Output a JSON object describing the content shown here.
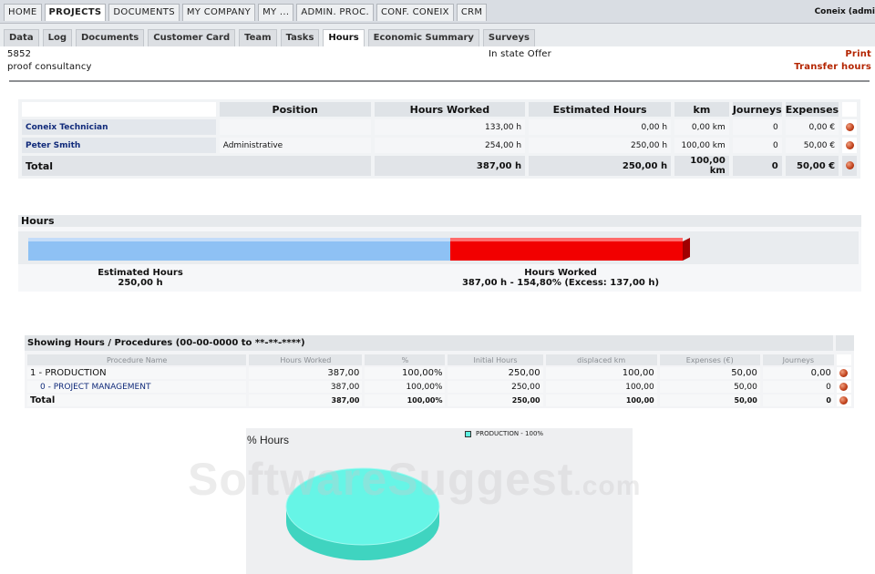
{
  "top_nav": {
    "tabs": [
      "HOME",
      "PROJECTS",
      "DOCUMENTS",
      "MY COMPANY",
      "MY ...",
      "ADMIN. PROC.",
      "CONF. CONEIX",
      "CRM"
    ],
    "user_label": "Coneix (admi"
  },
  "sub_nav": {
    "tabs": [
      "Data",
      "Log",
      "Documents",
      "Customer Card",
      "Team",
      "Tasks",
      "Hours",
      "Economic Summary",
      "Surveys"
    ]
  },
  "project": {
    "id": "5852",
    "name": "proof consultancy",
    "state": "In state Offer",
    "print_label": "Print",
    "transfer_label": "Transfer hours"
  },
  "team_table": {
    "headers": [
      "Position",
      "Hours Worked",
      "Estimated Hours",
      "km",
      "Journeys",
      "Expenses"
    ],
    "rows": [
      {
        "name": "Coneix Technician",
        "position": "",
        "hours": "133,00 h",
        "estimated": "0,00 h",
        "km": "0,00 km",
        "journeys": "0",
        "expenses": "0,00 €"
      },
      {
        "name": "Peter Smith",
        "position": "Administrative",
        "hours": "254,00 h",
        "estimated": "250,00 h",
        "km": "100,00 km",
        "journeys": "0",
        "expenses": "50,00 €"
      }
    ],
    "total": {
      "name": "Total",
      "hours": "387,00 h",
      "estimated": "250,00 h",
      "km": "100,00 km",
      "journeys": "0",
      "expenses": "50,00 €"
    }
  },
  "hours_panel": {
    "title": "Hours",
    "estimated_label": "Estimated Hours",
    "estimated_value": "250,00 h",
    "worked_label": "Hours Worked",
    "worked_value": "387,00 h  - 154,80%   (Excess: 137,00 h)",
    "estimated_fraction": 0.646,
    "excess_fraction": 0.354,
    "colors": {
      "estimated": "#8ec1f4",
      "excess": "#f20000"
    }
  },
  "procedures": {
    "caption": "Showing Hours / Procedures (00-00-0000 to **-**-****)",
    "headers": [
      "Procedure Name",
      "Hours Worked",
      "%",
      "Initial Hours",
      "displaced km",
      "Expenses (€)",
      "Journeys"
    ],
    "rows": [
      {
        "name": "1 - PRODUCTION",
        "hours": "387,00",
        "pct": "100,00%",
        "initial": "250,00",
        "km": "100,00",
        "expenses": "50,00",
        "journeys": "0,00"
      },
      {
        "name": "0 - PROJECT MANAGEMENT",
        "hours": "387,00",
        "pct": "100,00%",
        "initial": "250,00",
        "km": "100,00",
        "expenses": "50,00",
        "journeys": "0"
      }
    ],
    "total": {
      "name": "Total",
      "hours": "387,00",
      "pct": "100,00%",
      "initial": "250,00",
      "km": "100,00",
      "expenses": "50,00",
      "journeys": "0"
    }
  },
  "pie_chart": {
    "title": "% Hours",
    "legend": "PRODUCTION - 100%",
    "color": "#5ef0e0"
  },
  "chart_data": {
    "type": "pie",
    "title": "% Hours",
    "categories": [
      "PRODUCTION"
    ],
    "values": [
      100
    ]
  },
  "watermark": {
    "main": "SoftwareSuggest",
    "suffix": ".com"
  }
}
